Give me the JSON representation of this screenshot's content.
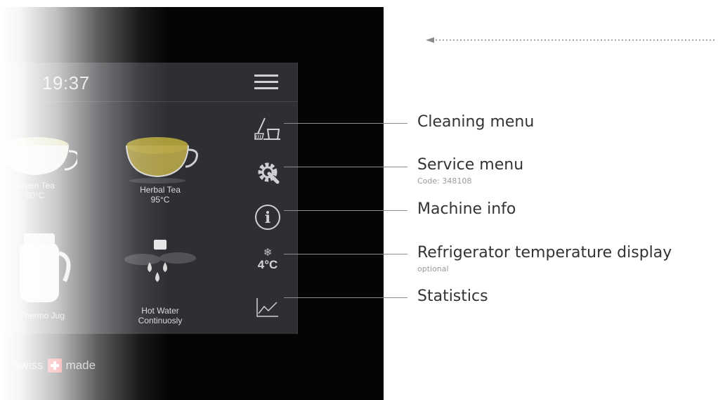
{
  "screen": {
    "clock": "19:37",
    "tiles": [
      {
        "name": "Green Tea",
        "sub": "80°C"
      },
      {
        "name": "Herbal Tea",
        "sub": "95°C"
      },
      {
        "name": "Thermo Jug",
        "sub": ""
      },
      {
        "name": "Hot Water",
        "sub": "Continuosly"
      }
    ],
    "fridge_temp": "4°C",
    "fridge_symbol": "❄",
    "brand": {
      "left": "swiss",
      "right": "made"
    }
  },
  "icons": {
    "menu": "hamburger-menu-icon",
    "cleaning": "broom-bucket-icon",
    "service": "gear-wrench-icon",
    "info": "info-circle-icon",
    "fridge": "snowflake-icon",
    "statistics": "line-chart-icon"
  },
  "callouts": [
    {
      "label": "Cleaning menu",
      "sub": ""
    },
    {
      "label": "Service menu",
      "sub": "Code: 348108"
    },
    {
      "label": "Machine info",
      "sub": ""
    },
    {
      "label": "Refrigerator temperature display",
      "sub": "optional"
    },
    {
      "label": "Statistics",
      "sub": ""
    }
  ],
  "colors": {
    "bezel": "#050506",
    "screen": "#2e2f33",
    "icon": "#cfd0d2",
    "swiss_red": "#e63a3a",
    "callout_text": "#333333"
  }
}
